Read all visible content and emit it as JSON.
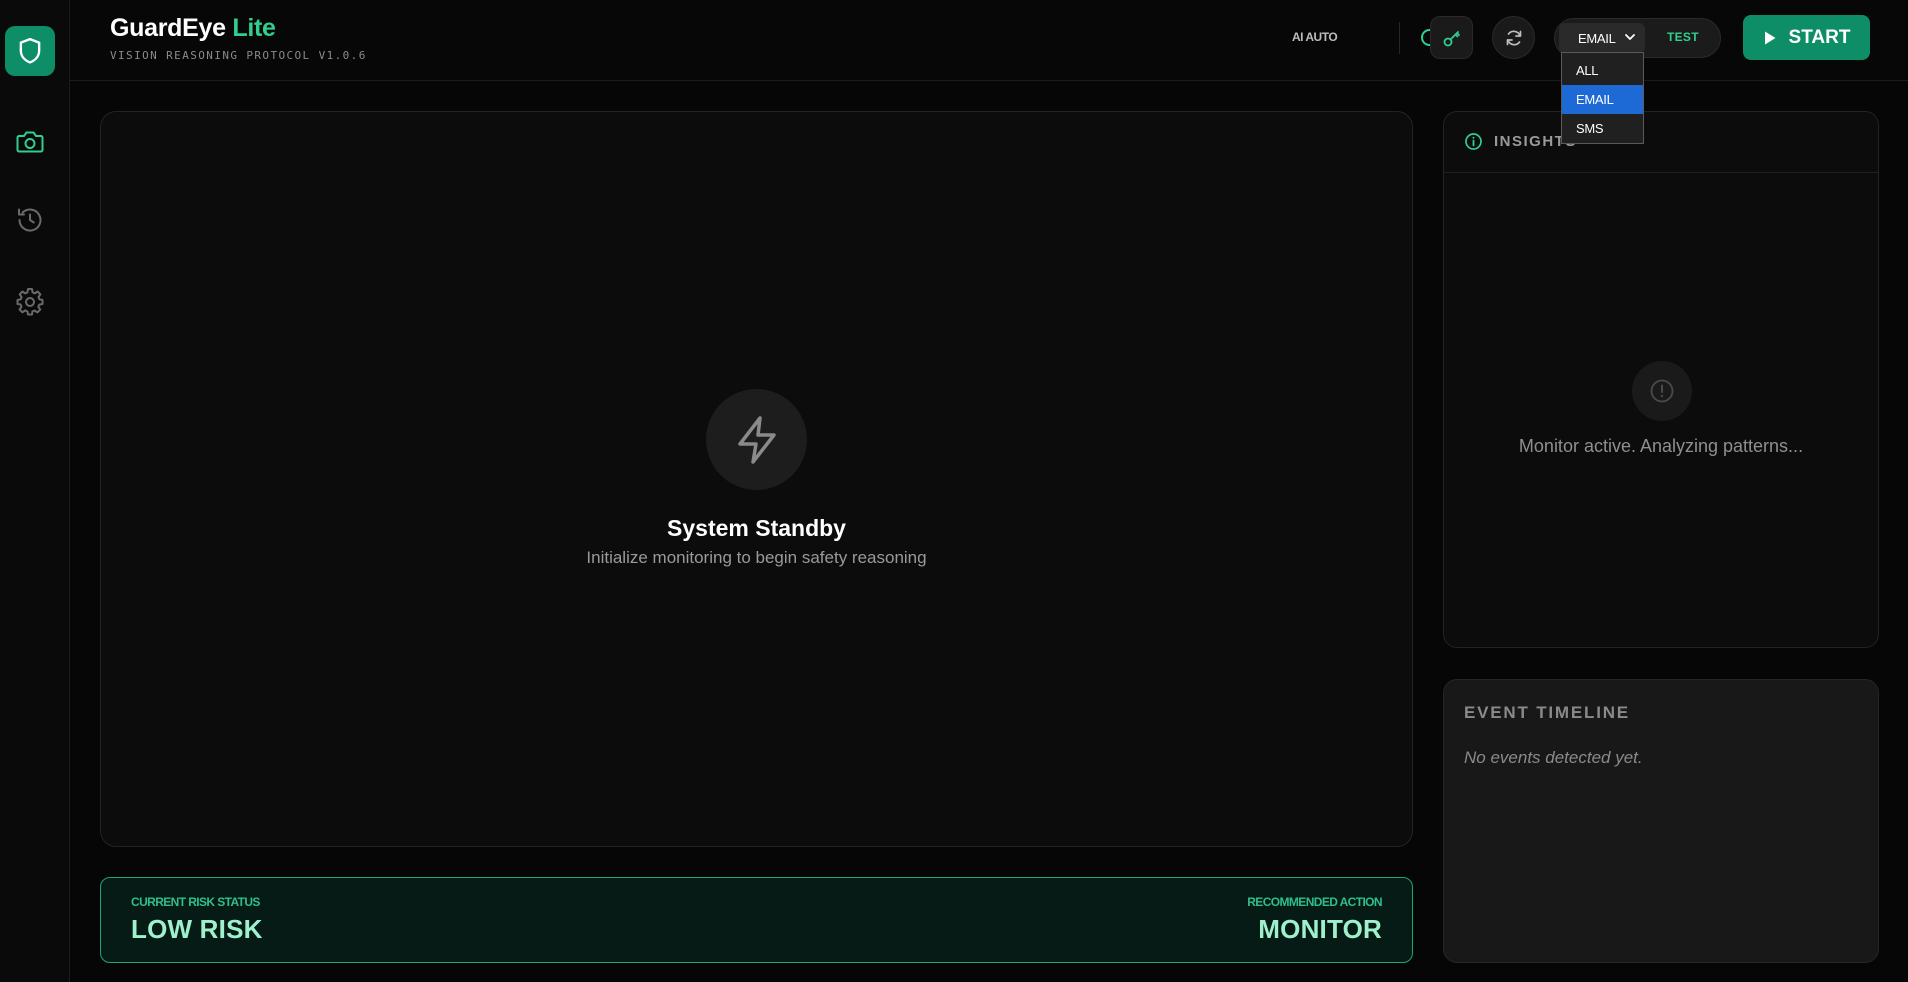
{
  "app": {
    "title": "GuardEye",
    "title_accent": "Lite",
    "subtitle": "VISION REASONING PROTOCOL V1.0.6"
  },
  "sidebar": {
    "items": [
      {
        "icon": "shield-icon",
        "active": true
      },
      {
        "icon": "camera-icon"
      },
      {
        "icon": "history-icon"
      },
      {
        "icon": "settings-icon"
      }
    ]
  },
  "header": {
    "ai_auto_label": "AI AUTO",
    "ai_auto_enabled": true,
    "notify_selected": "EMAIL",
    "test_label": "TEST",
    "start_label": "START"
  },
  "dropdown": {
    "options": [
      "ALL",
      "EMAIL",
      "SMS"
    ],
    "selected_index": 1
  },
  "feed": {
    "title": "System Standby",
    "subtitle": "Initialize monitoring to begin safety reasoning"
  },
  "risk": {
    "status_label": "CURRENT RISK STATUS",
    "status_value": "LOW RISK",
    "action_label": "RECOMMENDED ACTION",
    "action_value": "MONITOR"
  },
  "insights": {
    "title": "INSIGHTS",
    "message": "Monitor active. Analyzing patterns..."
  },
  "timeline": {
    "title": "EVENT TIMELINE",
    "empty": "No events detected yet."
  },
  "colors": {
    "accent": "#2fcf8f",
    "brand": "#0e8e66",
    "dropdown_selected": "#1d6ad6"
  }
}
